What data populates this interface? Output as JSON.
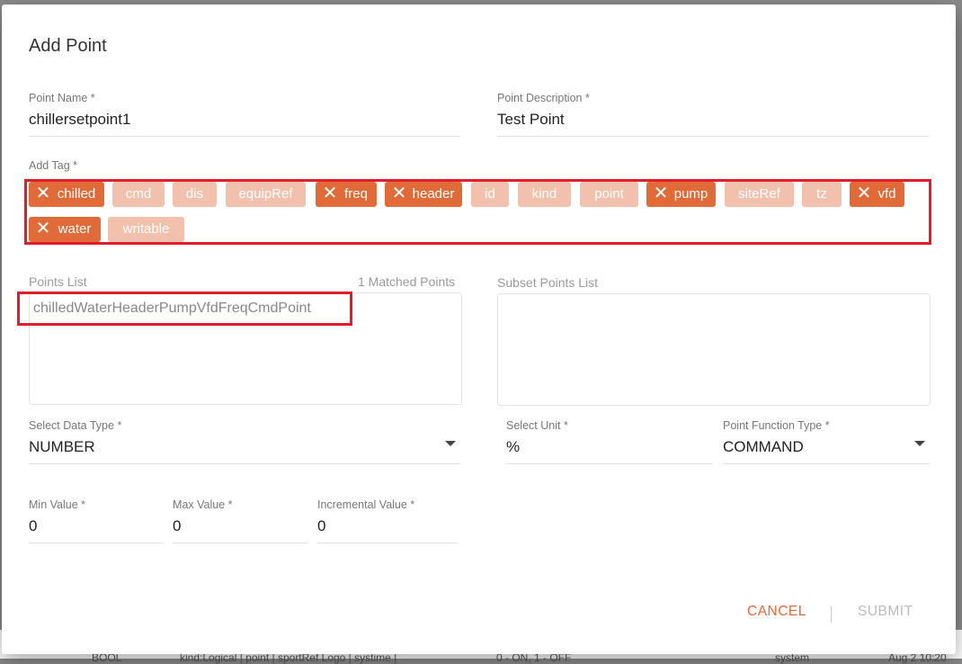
{
  "background_row": {
    "cells": [
      "BOOL",
      "kind:Logical | point | sportRef Logo | systime |",
      "0 - ON, 1 - OFF",
      "system",
      "Aug 2 10:20"
    ]
  },
  "dialog": {
    "title": "Add Point",
    "point_name": {
      "label": "Point Name",
      "value": "chillersetpoint1"
    },
    "point_description": {
      "label": "Point Description",
      "value": "Test Point"
    },
    "add_tag": {
      "label": "Add Tag",
      "tags": [
        {
          "label": "chilled",
          "selected": true
        },
        {
          "label": "cmd",
          "selected": false
        },
        {
          "label": "dis",
          "selected": false
        },
        {
          "label": "equipRef",
          "selected": false
        },
        {
          "label": "freq",
          "selected": true
        },
        {
          "label": "header",
          "selected": true
        },
        {
          "label": "id",
          "selected": false
        },
        {
          "label": "kind",
          "selected": false
        },
        {
          "label": "point",
          "selected": false
        },
        {
          "label": "pump",
          "selected": true
        },
        {
          "label": "siteRef",
          "selected": false
        },
        {
          "label": "tz",
          "selected": false
        },
        {
          "label": "vfd",
          "selected": true
        },
        {
          "label": "water",
          "selected": true
        },
        {
          "label": "writable",
          "selected": false
        }
      ]
    },
    "points_list": {
      "label": "Points List",
      "matched": "1 Matched Points",
      "items": [
        "chilledWaterHeaderPumpVfdFreqCmdPoint"
      ]
    },
    "subset_points_list": {
      "label": "Subset Points List",
      "items": []
    },
    "data_type": {
      "label": "Select Data Type",
      "value": "NUMBER"
    },
    "unit": {
      "label": "Select Unit",
      "value": "%"
    },
    "function_type": {
      "label": "Point Function Type",
      "value": "COMMAND"
    },
    "min_value": {
      "label": "Min Value",
      "value": "0"
    },
    "max_value": {
      "label": "Max Value",
      "value": "0"
    },
    "incremental_value": {
      "label": "Incremental Value",
      "value": "0"
    },
    "required_mark": "*",
    "tag_remove_glyph": "✕",
    "buttons": {
      "cancel": "CANCEL",
      "submit": "SUBMIT"
    },
    "colors": {
      "accent": "#e06a38",
      "tag_selected": "#e06a38",
      "tag_unselected": "#f2c1ad",
      "highlight_box": "#e21c2b"
    }
  }
}
